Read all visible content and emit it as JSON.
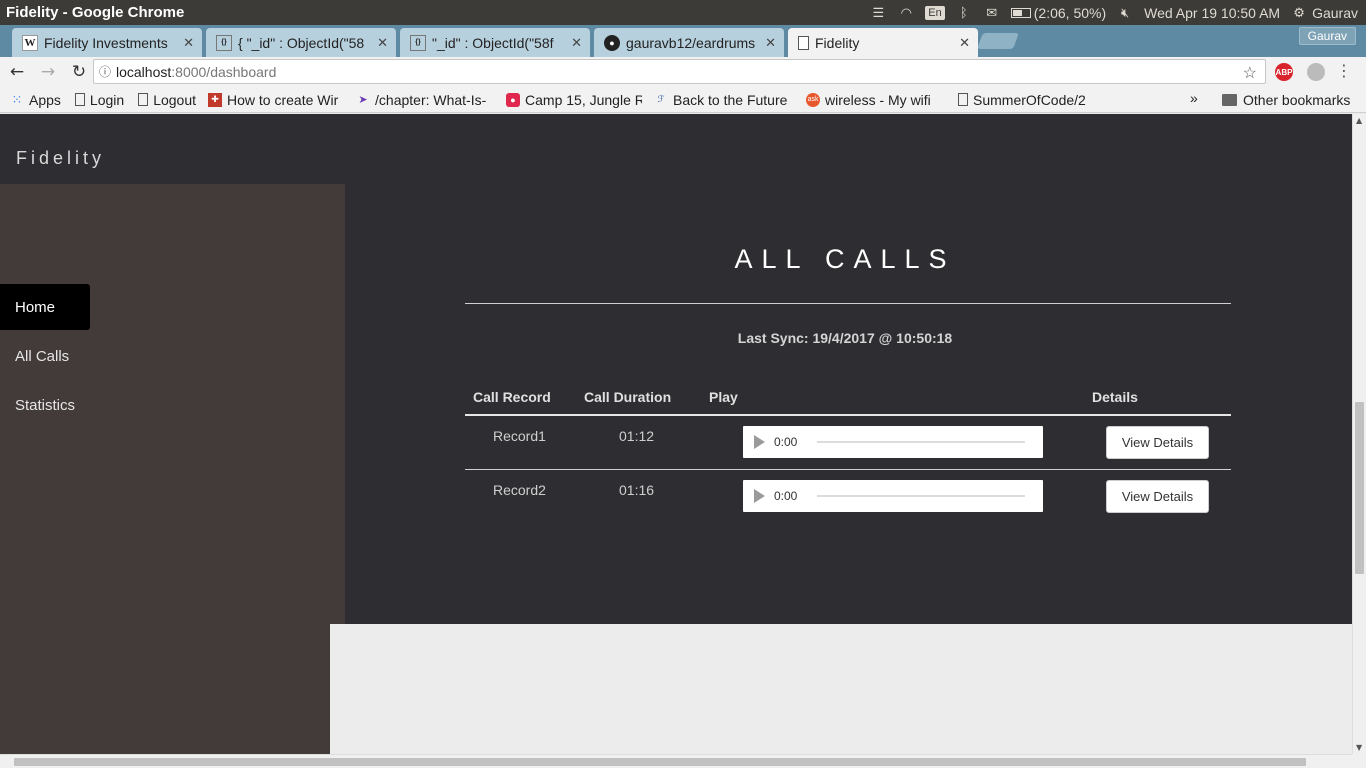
{
  "os": {
    "window_title": "Fidelity - Google Chrome",
    "language": "En",
    "battery": "(2:06, 50%)",
    "datetime": "Wed Apr 19 10:50 AM",
    "user": "Gaurav"
  },
  "browser": {
    "profile": "Gaurav",
    "tabs": [
      {
        "label": "Fidelity Investments",
        "icon": "wikipedia-icon"
      },
      {
        "label": "{ \"_id\" : ObjectId(\"58",
        "icon": "json-icon"
      },
      {
        "label": "\"_id\" : ObjectId(\"58f",
        "icon": "json-icon"
      },
      {
        "label": "gauravb12/eardrums",
        "icon": "github-icon"
      },
      {
        "label": "Fidelity",
        "icon": "page-icon"
      }
    ],
    "url_host": "localhost",
    "url_rest": ":8000/dashboard",
    "bookmarks": [
      {
        "label": "Apps",
        "icon": "apps-icon"
      },
      {
        "label": "Login",
        "icon": "page-icon"
      },
      {
        "label": "Logout",
        "icon": "page-icon"
      },
      {
        "label": "How to create Wir",
        "icon": "site-icon"
      },
      {
        "label": "/chapter: What-Is-",
        "icon": "site-icon"
      },
      {
        "label": "Camp 15, Jungle R",
        "icon": "site-icon"
      },
      {
        "label": "Back to the Future",
        "icon": "site-icon"
      },
      {
        "label": "wireless - My wifi",
        "icon": "ask-icon"
      },
      {
        "label": "SummerOfCode/2",
        "icon": "page-icon"
      }
    ],
    "overflow": "»",
    "other_bookmarks": "Other bookmarks"
  },
  "app": {
    "brand": "Fidelity",
    "nav": [
      {
        "label": "Home",
        "active": true
      },
      {
        "label": "All Calls",
        "active": false
      },
      {
        "label": "Statistics",
        "active": false
      }
    ],
    "heading": "ALL CALLS",
    "last_sync": "Last Sync: 19/4/2017 @ 10:50:18",
    "table": {
      "headers": [
        "Call Record",
        "Call Duration",
        "Play",
        "Details"
      ],
      "rows": [
        {
          "record": "Record1",
          "duration": "01:12",
          "time": "0:00",
          "button": "View Details"
        },
        {
          "record": "Record2",
          "duration": "01:16",
          "time": "0:00",
          "button": "View Details"
        }
      ]
    }
  }
}
